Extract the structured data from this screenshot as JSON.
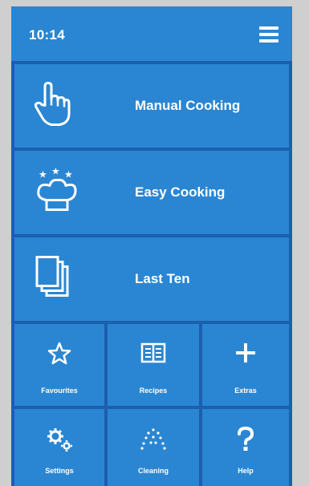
{
  "status": {
    "time": "10:14",
    "menu_icon": "hamburger-menu-icon"
  },
  "main_tiles": [
    {
      "label": "Manual Cooking",
      "icon": "pointing-hand-icon"
    },
    {
      "label": "Easy Cooking",
      "icon": "chef-hat-stars-icon"
    },
    {
      "label": "Last Ten",
      "icon": "stacked-pages-icon"
    }
  ],
  "grid_tiles": [
    {
      "label": "Favourites",
      "icon": "star-icon"
    },
    {
      "label": "Recipes",
      "icon": "book-icon"
    },
    {
      "label": "Extras",
      "icon": "plus-icon"
    },
    {
      "label": "Settings",
      "icon": "gears-icon"
    },
    {
      "label": "Cleaning",
      "icon": "spray-drops-icon"
    },
    {
      "label": "Help",
      "icon": "question-mark-icon"
    }
  ],
  "colors": {
    "tile": "#2a86d2",
    "background": "#1b5fae",
    "page": "#cfcfcf"
  }
}
